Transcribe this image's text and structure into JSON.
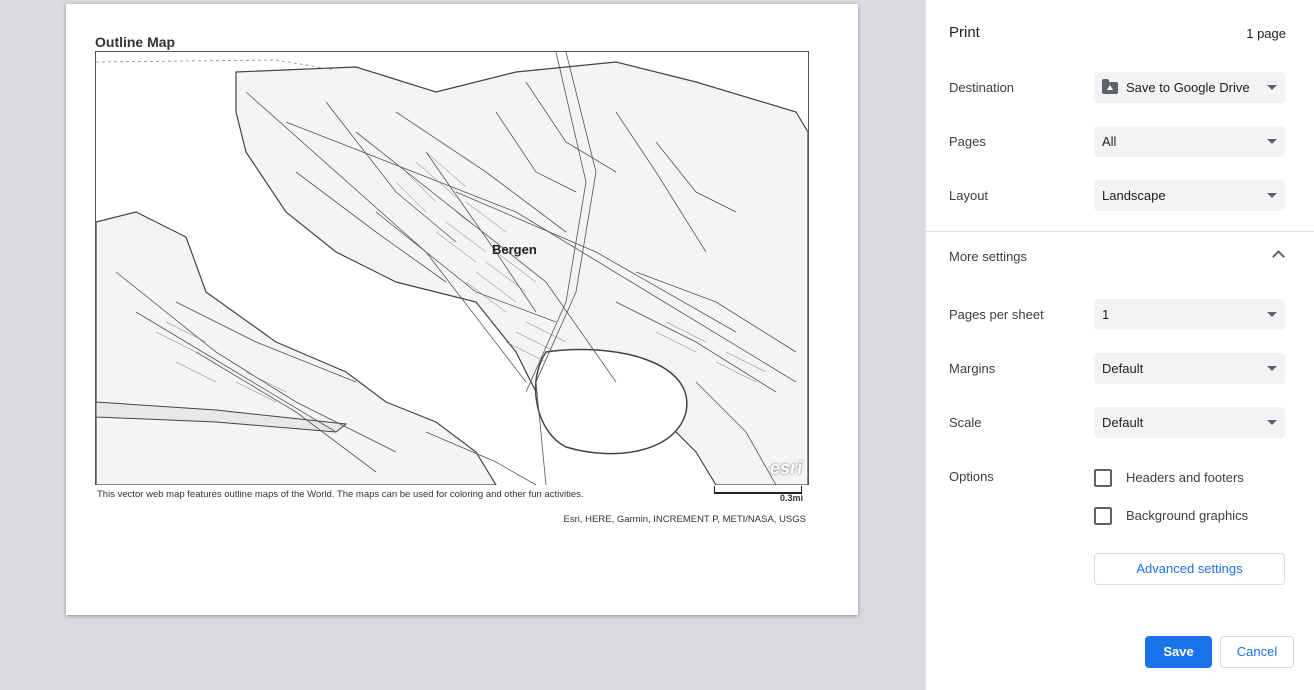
{
  "preview": {
    "map_title": "Outline Map",
    "city_label": "Bergen",
    "description": "This vector web map features outline maps of the World. The maps can be used for coloring and other fun activities.",
    "scale_label": "0.3mi",
    "credits": "Esri, HERE, Garmin, INCREMENT P, METI/NASA, USGS",
    "logo_text": "esri"
  },
  "panel": {
    "title": "Print",
    "page_count": "1 page",
    "destination": {
      "label": "Destination",
      "value": "Save to Google Drive",
      "icon": "google-drive-icon"
    },
    "pages": {
      "label": "Pages",
      "value": "All"
    },
    "layout": {
      "label": "Layout",
      "value": "Landscape"
    },
    "more_settings": "More settings",
    "pages_per_sheet": {
      "label": "Pages per sheet",
      "value": "1"
    },
    "margins": {
      "label": "Margins",
      "value": "Default"
    },
    "scale": {
      "label": "Scale",
      "value": "Default"
    },
    "options": {
      "label": "Options",
      "headers_footers": {
        "label": "Headers and footers",
        "checked": false
      },
      "background_graphics": {
        "label": "Background graphics",
        "checked": false
      }
    },
    "advanced_settings": "Advanced settings",
    "save": "Save",
    "cancel": "Cancel"
  },
  "colors": {
    "accent": "#1a73e8",
    "preview_background": "#dadbdf",
    "select_background": "#f1f3f4"
  }
}
